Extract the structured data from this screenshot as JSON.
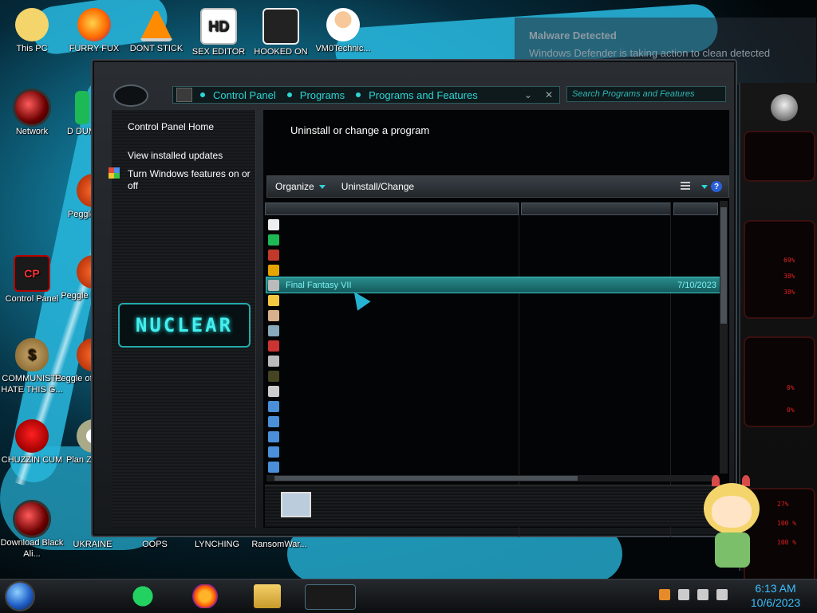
{
  "desktop": {
    "icons": [
      {
        "label": "This PC",
        "icon": "computer-icon"
      },
      {
        "label": "FURRY FUX",
        "icon": "firefox-icon"
      },
      {
        "label": "DONT STICK",
        "icon": "vlc-icon"
      },
      {
        "label": "SEX EDITOR",
        "icon": "hxd-icon"
      },
      {
        "label": "HOOKED ON",
        "icon": "maze-icon"
      },
      {
        "label": "VM0Technic...",
        "icon": "doctor-icon"
      },
      {
        "label": "Network",
        "icon": "network-orb-icon"
      },
      {
        "label": "D DUM",
        "icon": "app-icon"
      },
      {
        "label": "Peggle",
        "icon": "peggle-icon"
      },
      {
        "label": "Control Panel",
        "icon": "control-panel-icon"
      },
      {
        "label": "Peggle De",
        "icon": "peggle-icon"
      },
      {
        "label": "COMMUNISTS HATE THIS G...",
        "icon": "money-bag-icon"
      },
      {
        "label": "Peggle of Wa",
        "icon": "peggle-icon"
      },
      {
        "label": "CHUZZIN CUM",
        "icon": "chuzzle-icon"
      },
      {
        "label": "Plan Zo",
        "icon": "plants-icon"
      },
      {
        "label": "Download Black Ali...",
        "icon": "alien-orb-icon"
      },
      {
        "label": "UKRAINE",
        "icon": "app-icon"
      },
      {
        "label": "OOPS",
        "icon": "app-icon"
      },
      {
        "label": "LYNCHING",
        "icon": "app-icon"
      },
      {
        "label": "RansomWar...",
        "icon": "app-icon"
      }
    ]
  },
  "toast": {
    "title": "Malware Detected",
    "body": "Windows Defender is taking action to clean detected malware."
  },
  "window": {
    "breadcrumbs": [
      "Control Panel",
      "Programs",
      "Programs and Features"
    ],
    "search_placeholder": "Search Programs and Features",
    "nav": {
      "home": "Control Panel Home",
      "updates": "View installed updates",
      "features": "Turn Windows features on or off"
    },
    "brand": "NUCLEAR",
    "heading": "Uninstall or change a program",
    "toolbar": {
      "organize": "Organize",
      "uninstall_change": "Uninstall/Change"
    },
    "programs": [
      {
        "name": "",
        "icon": "7zip-icon",
        "date": ""
      },
      {
        "name": "",
        "icon": "spotify-icon",
        "date": ""
      },
      {
        "name": "",
        "icon": "devcpp-icon",
        "date": ""
      },
      {
        "name": "",
        "icon": "magnifier-icon",
        "date": ""
      },
      {
        "name": "Final Fantasy VII",
        "icon": "window-icon",
        "date": "7/10/2023",
        "selected": true
      },
      {
        "name": "",
        "icon": "hxd-icon",
        "date": ""
      },
      {
        "name": "",
        "icon": "person-icon",
        "date": ""
      },
      {
        "name": "",
        "icon": "tools-icon",
        "date": ""
      },
      {
        "name": "",
        "icon": "java-icon",
        "date": ""
      },
      {
        "name": "",
        "icon": "window-icon",
        "date": ""
      },
      {
        "name": "",
        "icon": "figure-icon",
        "date": ""
      },
      {
        "name": "",
        "icon": "window-icon",
        "date": ""
      },
      {
        "name": "",
        "icon": "installer-icon",
        "date": ""
      },
      {
        "name": "",
        "icon": "installer-icon",
        "date": ""
      },
      {
        "name": "",
        "icon": "installer-icon",
        "date": ""
      },
      {
        "name": "",
        "icon": "installer-icon",
        "date": ""
      },
      {
        "name": "",
        "icon": "installer-icon",
        "date": ""
      }
    ]
  },
  "gadgets": {
    "labels": [
      "69%",
      "38%",
      "38%",
      "0%",
      "0%",
      "27%",
      "100 %",
      "100 %"
    ]
  },
  "taskbar": {
    "time": "6:13 AM",
    "date": "10/6/2023"
  }
}
